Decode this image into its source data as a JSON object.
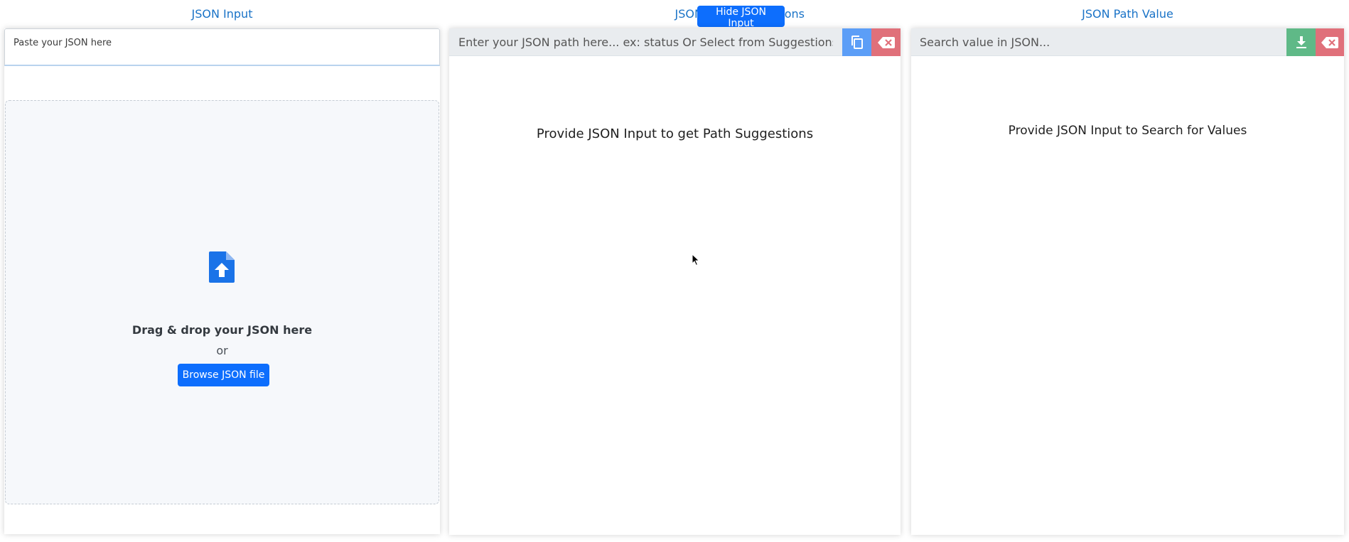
{
  "left": {
    "title": "JSON Input",
    "textarea_placeholder": "Paste your JSON here",
    "dropzone": {
      "icon": "file-upload-icon",
      "title": "Drag & drop your JSON here",
      "or_text": "or",
      "browse_label": "Browse JSON file"
    }
  },
  "middle": {
    "title": "JSON Path Suggestions",
    "hide_button_label": "Hide JSON Input",
    "path_input_placeholder": "Enter your JSON path here... ex: status Or Select from Suggestions",
    "copy_icon": "copy-icon",
    "clear_icon": "backspace-clear-icon",
    "message": "Provide JSON Input to get Path Suggestions"
  },
  "right": {
    "title": "JSON Path Value",
    "search_placeholder": "Search value in JSON...",
    "download_icon": "download-icon",
    "clear_icon": "backspace-clear-icon",
    "message": "Provide JSON Input to Search for Values"
  },
  "colors": {
    "accent_blue": "#0d6efd",
    "title_blue": "#1a73c7",
    "copy_blue": "#5c9ef7",
    "clear_red": "#e0707a",
    "download_green": "#5fb987"
  }
}
